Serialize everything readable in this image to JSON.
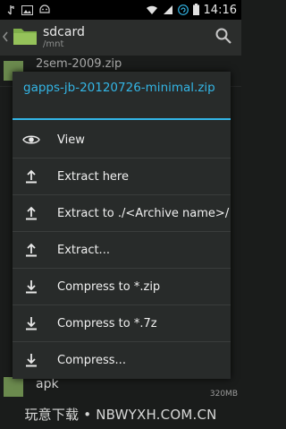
{
  "status_bar": {
    "time": "14:16",
    "icons": [
      "usb-icon",
      "image-icon",
      "android-debug-icon",
      "wifi-icon",
      "signal-icon",
      "sync-icon",
      "battery-icon"
    ]
  },
  "action_bar": {
    "title": "sdcard",
    "subtitle": "/mnt",
    "search_icon": "search-icon"
  },
  "background_list": {
    "first_item": "2sem-2009.zip",
    "last_item": {
      "name": "apk",
      "size": "320MB"
    }
  },
  "dialog": {
    "title": "gapps-jb-20120726-minimal.zip",
    "accent_color": "#33b5e5",
    "items": [
      {
        "label": "View",
        "icon": "eye-icon"
      },
      {
        "label": "Extract here",
        "icon": "extract-icon"
      },
      {
        "label": "Extract to ./<Archive name>/",
        "icon": "extract-icon"
      },
      {
        "label": "Extract...",
        "icon": "extract-icon"
      },
      {
        "label": "Compress to *.zip",
        "icon": "compress-icon"
      },
      {
        "label": "Compress to *.7z",
        "icon": "compress-icon"
      },
      {
        "label": "Compress...",
        "icon": "compress-icon"
      }
    ]
  },
  "watermark": "玩意下载 • NBWYXH.COM.CN"
}
